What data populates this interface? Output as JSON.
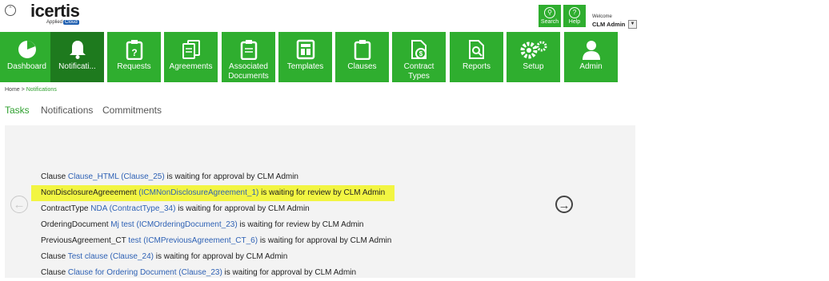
{
  "header": {
    "logo_main": "icertis",
    "logo_sub": "Applied",
    "logo_badge": "Cloud",
    "search_label": "Search",
    "help_label": "Help",
    "welcome": "Welcome",
    "user": "CLM Admin"
  },
  "nav": [
    {
      "label": "Dashboard",
      "icon": "pie-chart-icon"
    },
    {
      "label": "Notificati...",
      "icon": "bell-icon",
      "active": true
    },
    {
      "label": "Requests",
      "icon": "clipboard-question-icon"
    },
    {
      "label": "Agreements",
      "icon": "documents-icon"
    },
    {
      "label": "Associated Documents",
      "icon": "clipboard-icon"
    },
    {
      "label": "Templates",
      "icon": "template-icon"
    },
    {
      "label": "Clauses",
      "icon": "clipboard-icon"
    },
    {
      "label": "Contract Types",
      "icon": "contract-dollar-icon"
    },
    {
      "label": "Reports",
      "icon": "report-icon"
    },
    {
      "label": "Setup",
      "icon": "gears-icon"
    },
    {
      "label": "Admin",
      "icon": "user-icon"
    }
  ],
  "breadcrumb": {
    "home": "Home",
    "sep": ">",
    "current": "Notifications"
  },
  "tabs": [
    {
      "label": "Tasks",
      "active": true
    },
    {
      "label": "Notifications"
    },
    {
      "label": "Commitments"
    }
  ],
  "tasks": [
    {
      "prefix": "Clause ",
      "link": "Clause_HTML (Clause_25)",
      "suffix": " is waiting for approval by CLM Admin"
    },
    {
      "prefix": "NonDisclosureAgreeement ",
      "link": "(ICMNonDisclosureAgreement_1)",
      "suffix": " is waiting for review by CLM Admin",
      "highlight": true
    },
    {
      "prefix": "ContractType ",
      "link": "NDA (ContractType_34)",
      "suffix": " is waiting for approval by CLM Admin"
    },
    {
      "prefix": "OrderingDocument ",
      "link": "Mj test (ICMOrderingDocument_23)",
      "suffix": " is waiting for review by CLM Admin"
    },
    {
      "prefix": "PreviousAgreement_CT ",
      "link": "test (ICMPreviousAgreement_CT_6)",
      "suffix": " is waiting for approval by CLM Admin"
    },
    {
      "prefix": "Clause ",
      "link": "Test clause (Clause_24)",
      "suffix": " is waiting for approval by CLM Admin"
    },
    {
      "prefix": "Clause ",
      "link": "Clause for Ordering Document (Clause_23)",
      "suffix": " is waiting for approval by CLM Admin"
    }
  ],
  "colors": {
    "brand_green": "#2fae2f",
    "active_green": "#1e7a1e",
    "link_blue": "#2f62b5",
    "highlight": "#f2f542"
  }
}
